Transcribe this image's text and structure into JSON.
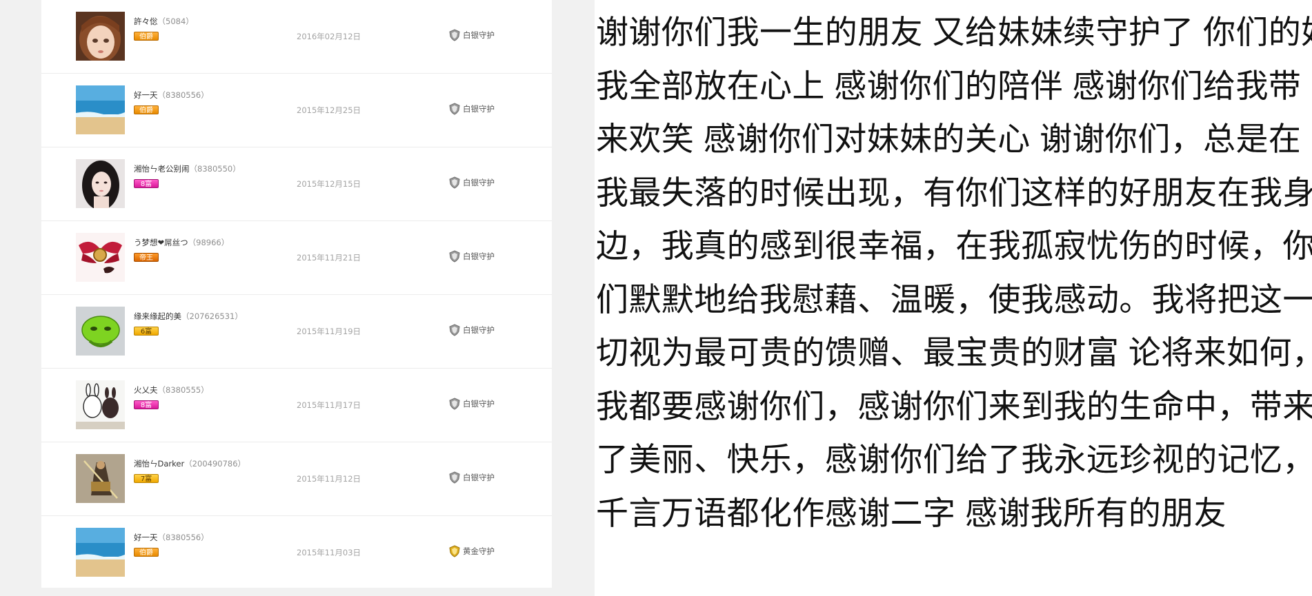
{
  "guard_list": {
    "rows": [
      {
        "name": "許々倊",
        "id": "（5084）",
        "badge": "伯爵",
        "badge_style": "badge-gold",
        "date": "2016年02月12日",
        "guard": "白银守护",
        "guard_color": "#888888",
        "avatar": "doll-avatar"
      },
      {
        "name": "好一天",
        "id": "（8380556）",
        "badge": "伯爵",
        "badge_style": "badge-gold",
        "date": "2015年12月25日",
        "guard": "白银守护",
        "guard_color": "#888888",
        "avatar": "beach-avatar"
      },
      {
        "name": "湘怡ㄣ老公别闹",
        "id": "（8380550）",
        "badge": "8富",
        "badge_style": "badge-pink",
        "date": "2015年12月15日",
        "guard": "白银守护",
        "guard_color": "#888888",
        "avatar": "girl-avatar"
      },
      {
        "name": "う梦想❤屌丝つ",
        "id": "（98966）",
        "badge": "帝王",
        "badge_style": "badge-bronze",
        "date": "2015年11月21日",
        "guard": "白银守护",
        "guard_color": "#888888",
        "avatar": "wings-avatar"
      },
      {
        "name": "缘来缘起的美",
        "id": "（207626531）",
        "badge": "6富",
        "badge_style": "badge-yellow",
        "date": "2015年11月19日",
        "guard": "白银守护",
        "guard_color": "#888888",
        "avatar": "green-blob-avatar"
      },
      {
        "name": "火乂夫",
        "id": "（8380555）",
        "badge": "8富",
        "badge_style": "badge-pink",
        "date": "2015年11月17日",
        "guard": "白银守护",
        "guard_color": "#888888",
        "avatar": "cartoon-avatar"
      },
      {
        "name": "湘怡ㄣDarker",
        "id": "（200490786）",
        "badge": "7富",
        "badge_style": "badge-yellow",
        "date": "2015年11月12日",
        "guard": "白银守护",
        "guard_color": "#888888",
        "avatar": "warrior-avatar"
      },
      {
        "name": "好一天",
        "id": "（8380556）",
        "badge": "伯爵",
        "badge_style": "badge-gold",
        "date": "2015年11月03日",
        "guard": "黄金守护",
        "guard_color": "#d4a20a",
        "avatar": "beach-avatar"
      }
    ]
  },
  "letter": {
    "lines": [
      "谢谢你们我一生的朋友 又给妹妹续守护了 你们的好",
      "我全部放在心上  感谢你们的陪伴 感谢你们给我带",
      "来欢笑  感谢你们对妹妹的关心  谢谢你们，总是在",
      "我最失落的时候出现，有你们这样的好朋友在我身",
      "边，我真的感到很幸福，在我孤寂忧伤的时候，你",
      "们默默地给我慰藉、温暖，使我感动。我将把这一",
      "切视为最可贵的馈赠、最宝贵的财富  论将来如何，",
      "我都要感谢你们，感谢你们来到我的生命中，带来",
      "了美丽、快乐，感谢你们给了我永远珍视的记忆，",
      "千言万语都化作感谢二字 感谢我所有的朋友"
    ]
  }
}
